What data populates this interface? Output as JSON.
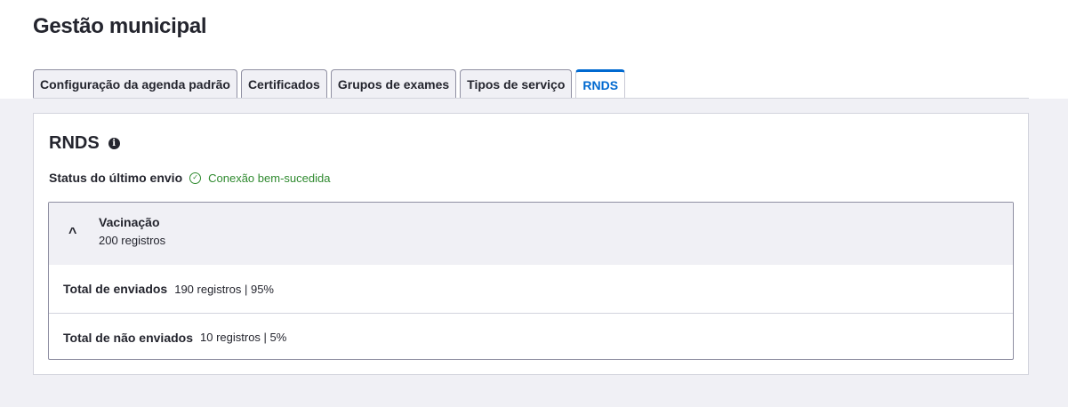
{
  "page_title": "Gestão municipal",
  "tabs": [
    {
      "label": "Configuração da agenda padrão"
    },
    {
      "label": "Certificados"
    },
    {
      "label": "Grupos de exames"
    },
    {
      "label": "Tipos de serviço"
    },
    {
      "label": "RNDS",
      "active": true
    }
  ],
  "card": {
    "title": "RNDS",
    "status_label": "Status do último envio",
    "status_value": "Conexão bem-sucedida",
    "accordion": {
      "title": "Vacinação",
      "subtitle": "200 registros",
      "rows": [
        {
          "label": "Total de enviados",
          "value": "190 registros | 95%"
        },
        {
          "label": "Total de não enviados",
          "value": "10 registros | 5%"
        }
      ]
    }
  },
  "colors": {
    "accent": "#0069d0",
    "success": "#2f8a2f",
    "background": "#f0f0f5"
  }
}
